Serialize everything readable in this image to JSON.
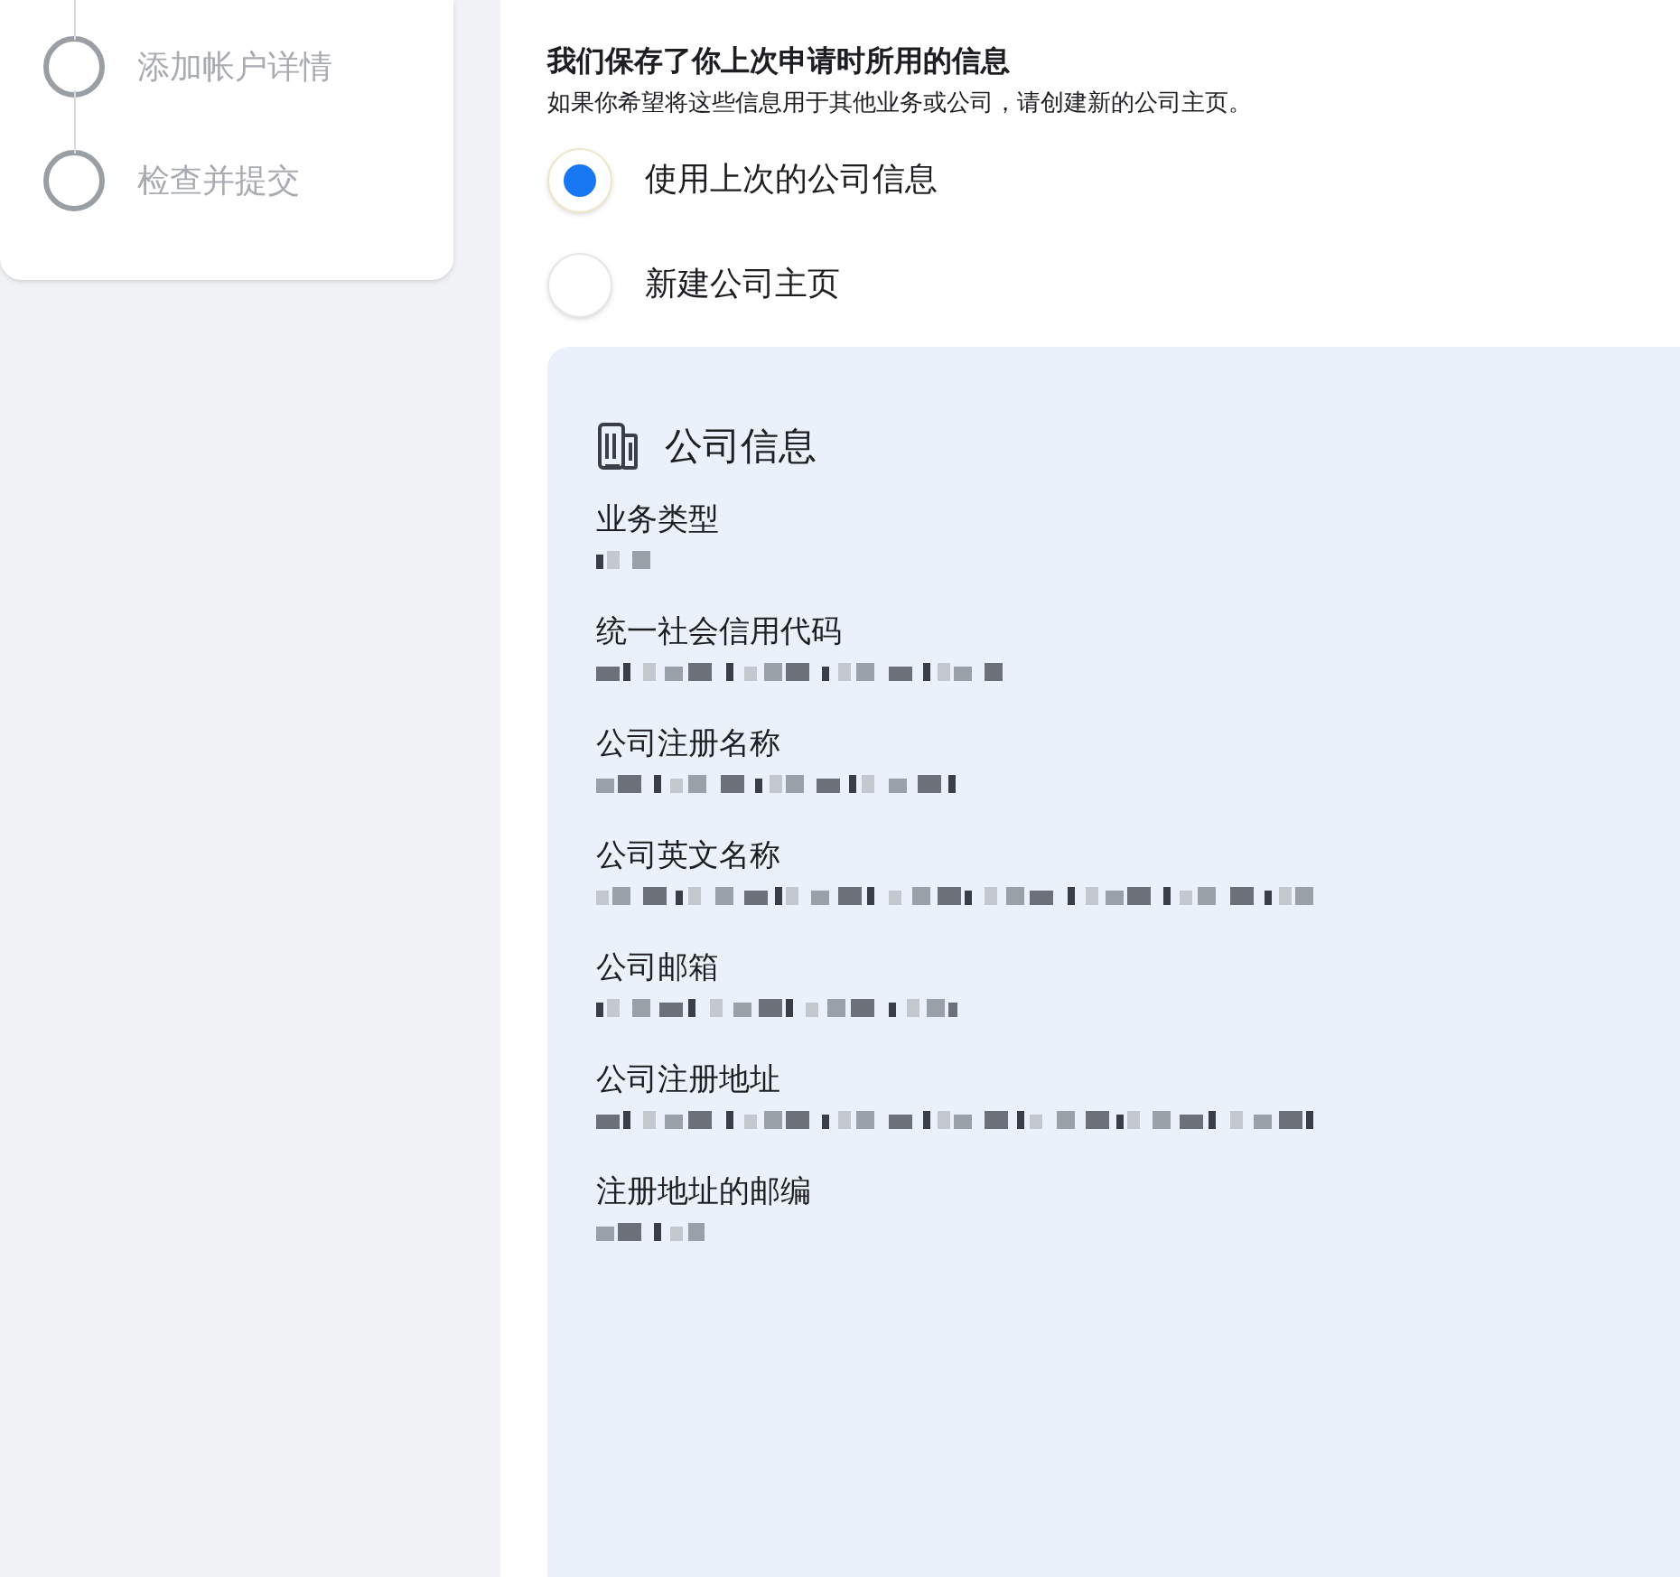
{
  "steps": [
    {
      "label": "添加帐户详情",
      "done": false
    },
    {
      "label": "检查并提交",
      "done": false
    }
  ],
  "heading": "我们保存了你上次申请时所用的信息",
  "subheading": "如果你希望将这些信息用于其他业务或公司，请创建新的公司主页。",
  "options": [
    {
      "label": "使用上次的公司信息",
      "selected": true
    },
    {
      "label": "新建公司主页",
      "selected": false
    }
  ],
  "company_card": {
    "title": "公司信息",
    "fields": [
      {
        "label": "业务类型",
        "kind": "redacted"
      },
      {
        "label": "统一社会信用代码",
        "kind": "redacted"
      },
      {
        "label": "公司注册名称",
        "kind": "redacted"
      },
      {
        "label": "公司英文名称",
        "kind": "redacted"
      },
      {
        "label": "公司邮箱",
        "kind": "redacted"
      },
      {
        "label": "公司注册地址",
        "kind": "redacted"
      },
      {
        "label": "注册地址的邮编",
        "kind": "redacted"
      }
    ]
  }
}
